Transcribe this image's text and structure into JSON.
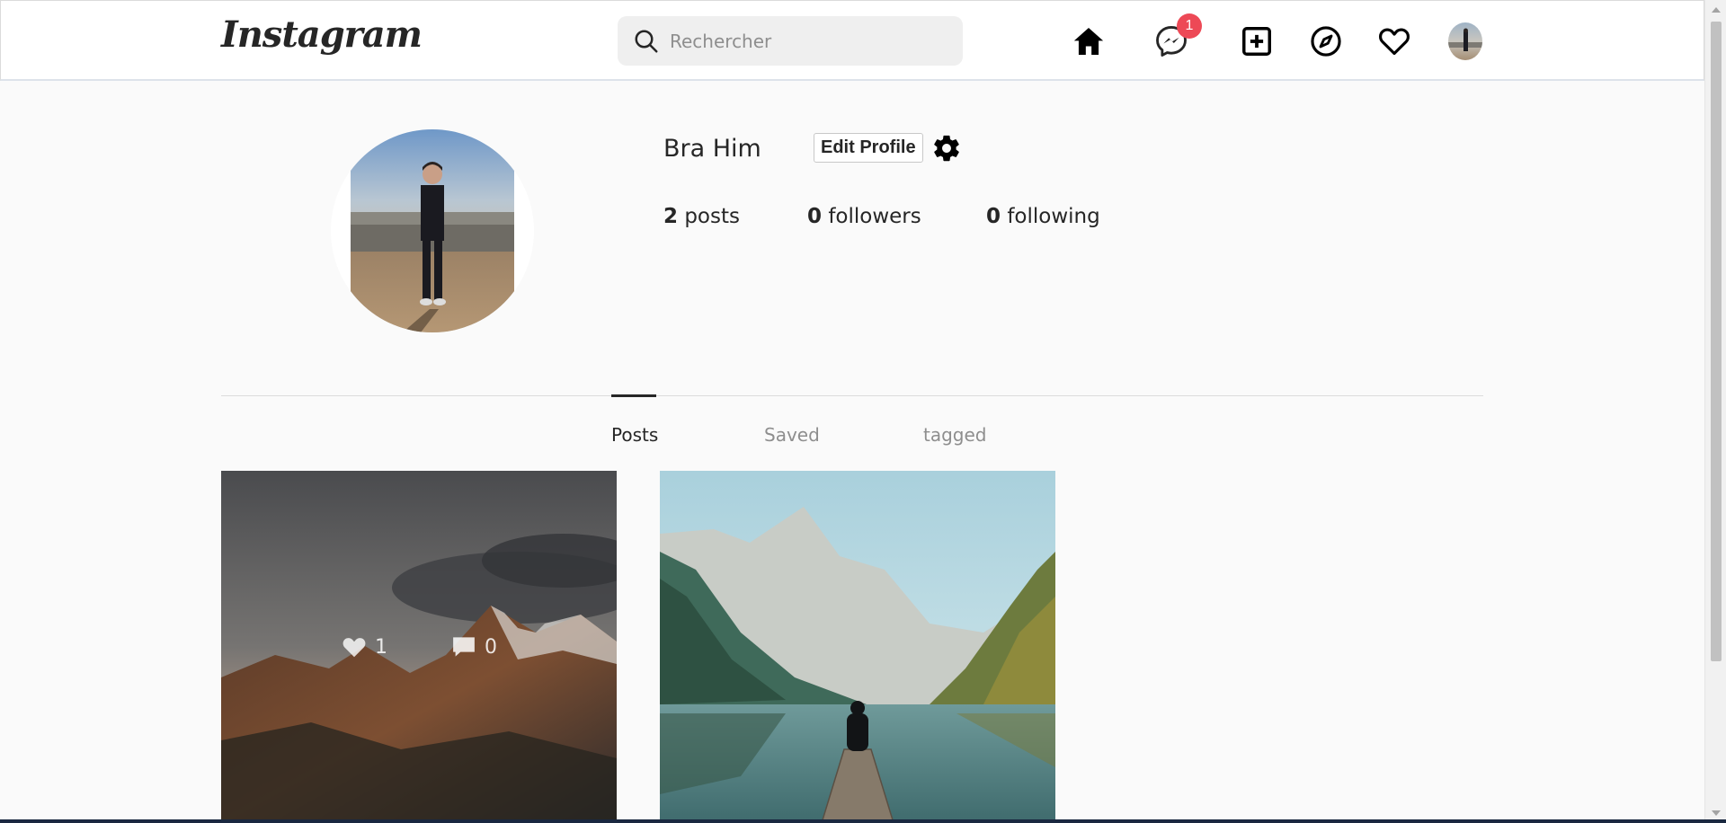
{
  "navbar": {
    "logo": "Instagram",
    "search_placeholder": "Rechercher",
    "icons": [
      "home-icon",
      "messenger-icon",
      "new-post-icon",
      "explore-icon",
      "activity-heart-icon",
      "profile-avatar"
    ],
    "messages_badge": "1",
    "badge_color": "#ed4956"
  },
  "profile": {
    "username": "Bra Him",
    "edit_button": "Edit Profile",
    "stats": {
      "posts_count": "2",
      "posts_label": "posts",
      "followers_count": "0",
      "followers_label": "followers",
      "following_count": "0",
      "following_label": "following"
    }
  },
  "tabs": [
    {
      "label": "Posts",
      "active": true
    },
    {
      "label": "Saved",
      "active": false
    },
    {
      "label": "tagged",
      "active": false
    }
  ],
  "posts": [
    {
      "likes": "1",
      "comments": "0",
      "overlay_visible": true
    },
    {
      "likes": "",
      "comments": "",
      "overlay_visible": false
    }
  ]
}
